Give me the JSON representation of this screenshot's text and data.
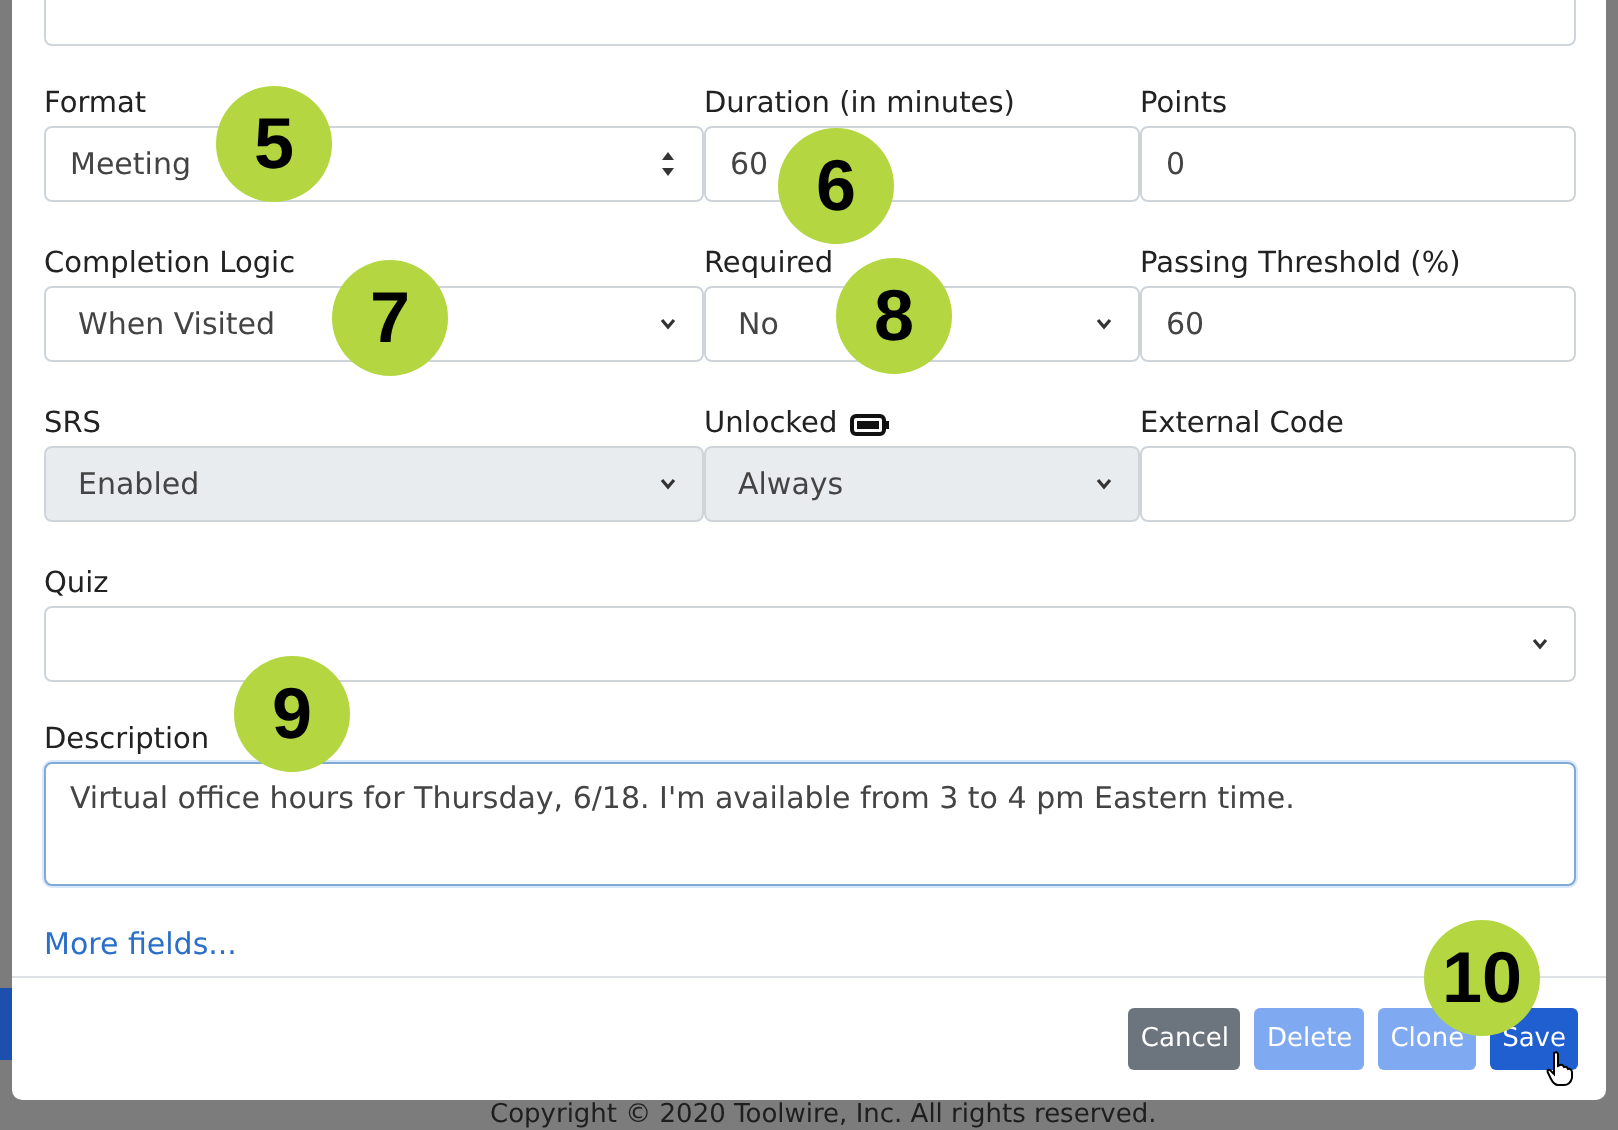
{
  "top_field": {
    "kind": "textarea"
  },
  "rows": [
    [
      {
        "label": "Format",
        "kind": "spinner",
        "value": "Meeting",
        "disabled": false,
        "callout": "5"
      },
      {
        "label": "Duration (in minutes)",
        "kind": "input",
        "value": "60",
        "disabled": false,
        "callout": "6"
      },
      {
        "label": "Points",
        "kind": "input",
        "value": "0",
        "disabled": false
      }
    ],
    [
      {
        "label": "Completion Logic",
        "kind": "select",
        "value": "When Visited",
        "disabled": false,
        "callout": "7"
      },
      {
        "label": "Required",
        "kind": "select",
        "value": "No",
        "disabled": false,
        "callout": "8"
      },
      {
        "label": "Passing Threshold (%)",
        "kind": "input",
        "value": "60",
        "disabled": false
      }
    ],
    [
      {
        "label": "SRS",
        "kind": "select",
        "value": "Enabled",
        "disabled": true
      },
      {
        "label": "Unlocked",
        "icon": true,
        "kind": "select",
        "value": "Always",
        "disabled": true
      },
      {
        "label": "External Code",
        "kind": "input",
        "disabled": false
      }
    ],
    [
      {
        "label": "Quiz",
        "kind": "select",
        "disabled": false
      }
    ]
  ],
  "description": {
    "label": "Description",
    "value": "Virtual office hours for Thursday, 6/18. I'm available from 3 to 4 pm Eastern time.",
    "focused": true,
    "callout": "9"
  },
  "more_link": "More fields...",
  "buttons": [
    {
      "label": "Cancel",
      "kind": "secondary",
      "disabled": false
    },
    {
      "label": "Delete",
      "kind": "primary",
      "disabled": true
    },
    {
      "label": "Clone",
      "kind": "primary",
      "disabled": true
    },
    {
      "label": "Save",
      "kind": "primary",
      "disabled": false,
      "callout": "10",
      "hovered": true
    }
  ],
  "footer_text": "Copyright © 2020 Toolwire, Inc. All rights reserved."
}
